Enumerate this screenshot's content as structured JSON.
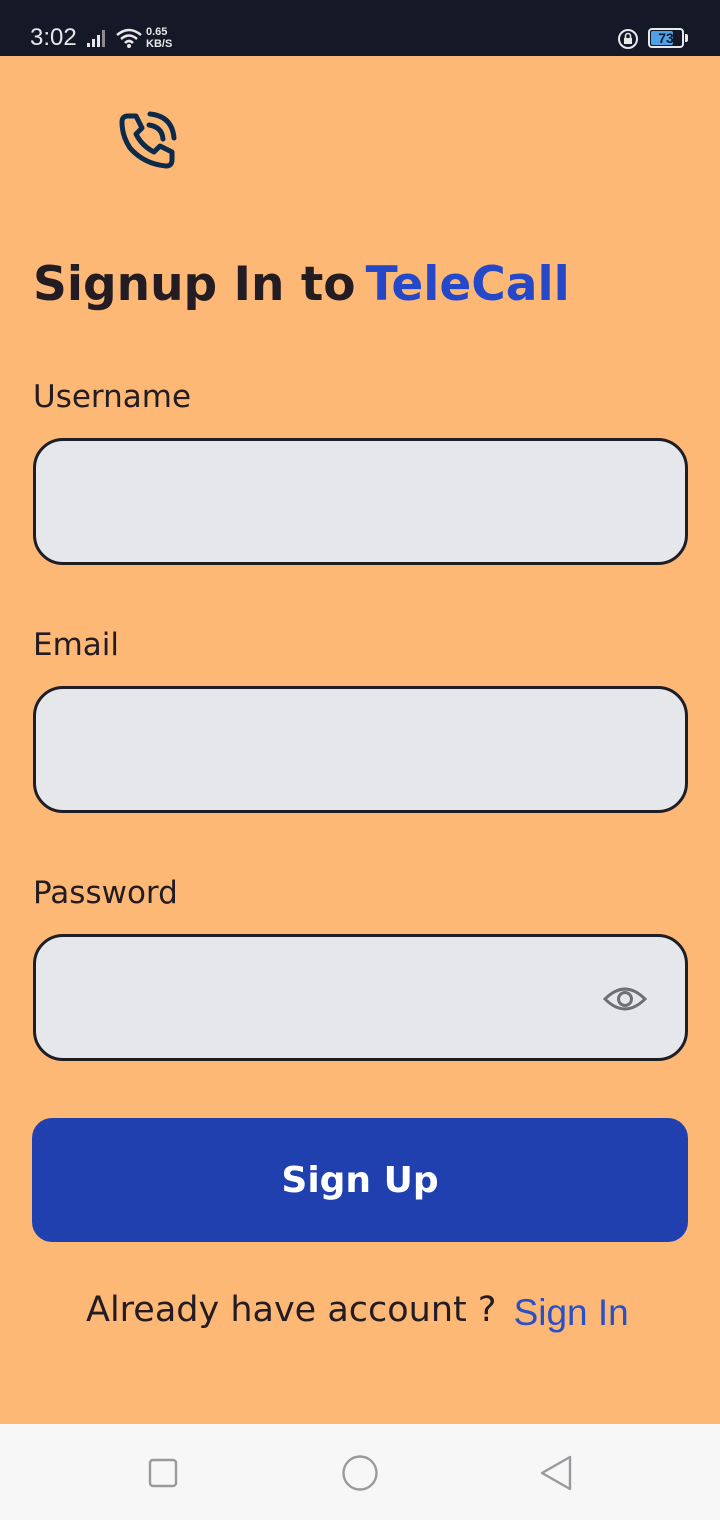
{
  "status_bar": {
    "time": "3:02",
    "net_speed_value": "0.65",
    "net_speed_unit": "KB/S",
    "battery_level": "73",
    "battery_fraction": 0.73,
    "icons": [
      "signal-icon",
      "wifi-icon",
      "rotation-lock-icon",
      "battery-icon"
    ]
  },
  "app": {
    "logo_icon": "phone-call-icon",
    "title_prefix": "Signup In to",
    "title_brand": "TeleCall",
    "brand_color": "#2448c8",
    "background_color": "#fdb876"
  },
  "form": {
    "username_label": "Username",
    "username_value": "",
    "email_label": "Email",
    "email_value": "",
    "password_label": "Password",
    "password_value": "",
    "password_toggle_icon": "eye-icon",
    "submit_label": "Sign Up",
    "submit_color": "#2040b0"
  },
  "footer": {
    "prompt": "Already have account ?",
    "signin_label": "Sign In"
  },
  "nav_bar": {
    "buttons": [
      "recent-apps-icon",
      "home-icon",
      "back-icon"
    ]
  }
}
